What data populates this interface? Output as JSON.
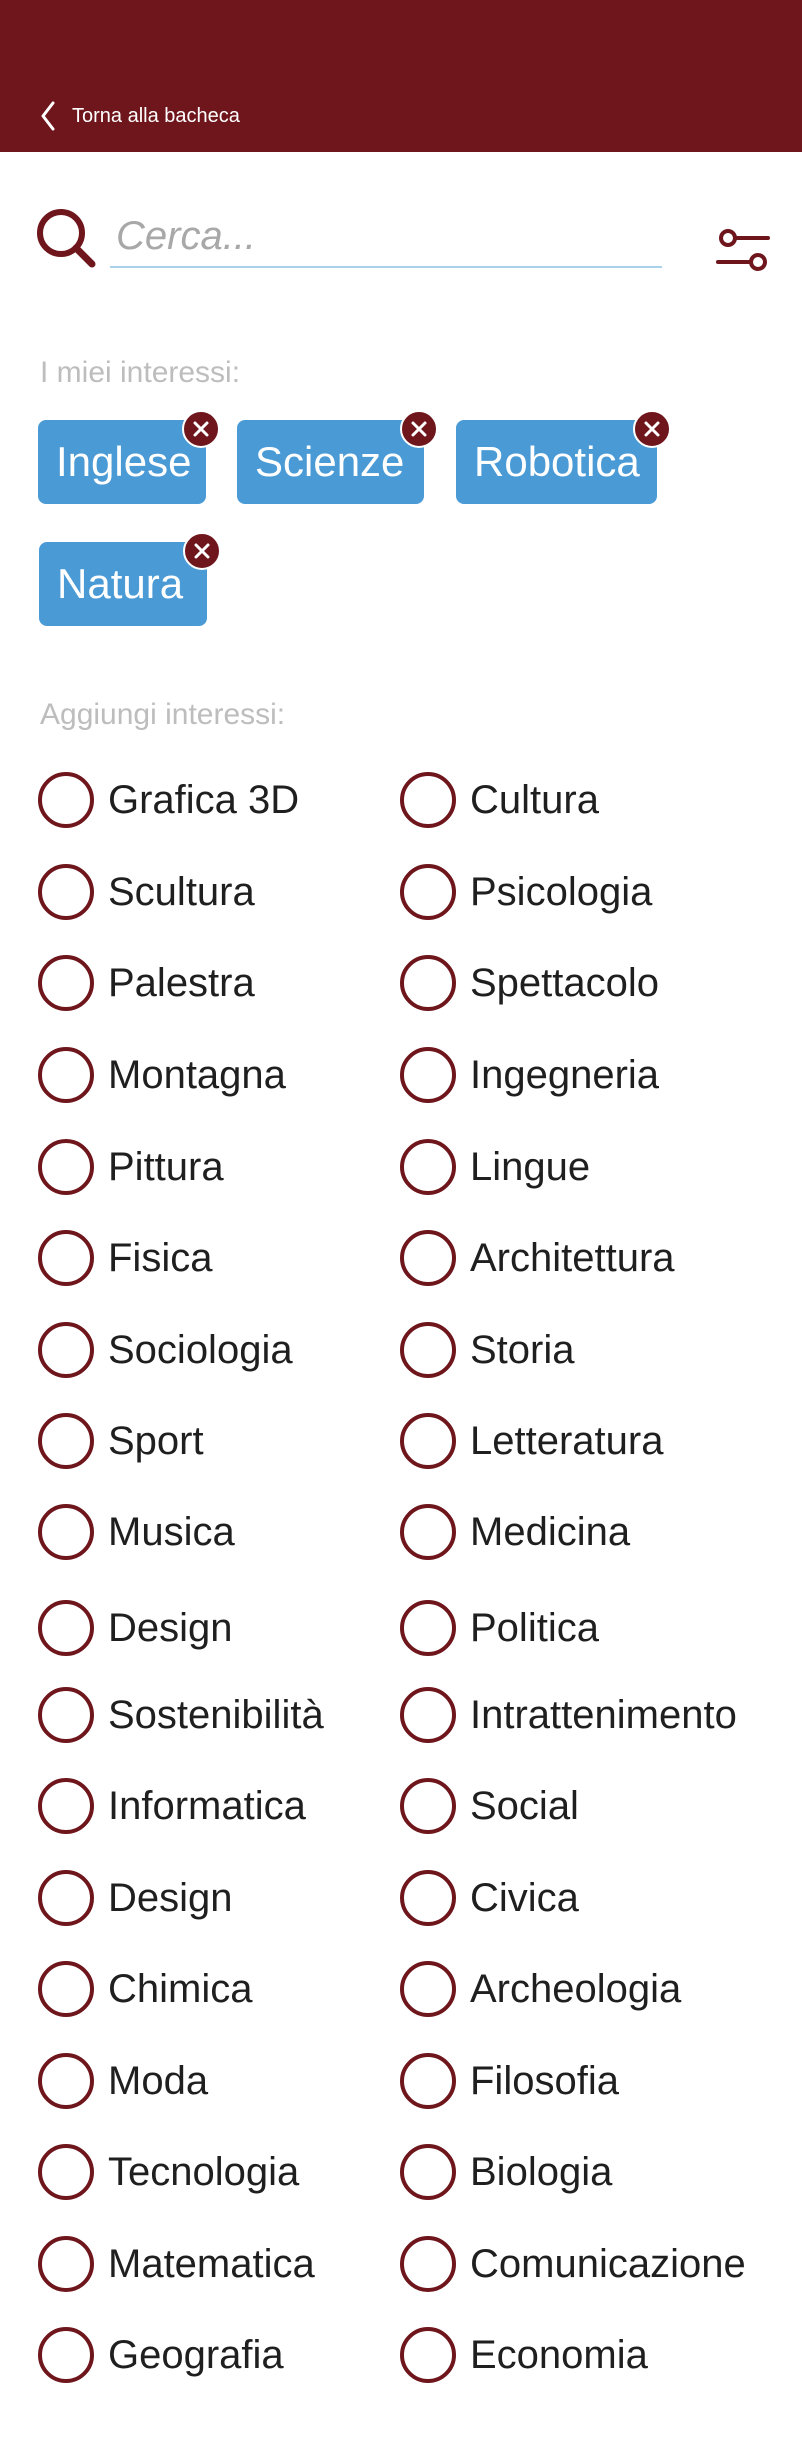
{
  "header": {
    "back_label": "Torna alla bacheca"
  },
  "search": {
    "placeholder": "Cerca..."
  },
  "my_interests": {
    "label": "I miei interessi:",
    "chips": [
      "Inglese",
      "Scienze",
      "Robotica",
      "Natura"
    ]
  },
  "add_interests": {
    "label": "Aggiungi interessi:",
    "rows": [
      [
        "Grafica 3D",
        "Cultura"
      ],
      [
        "Scultura",
        "Psicologia"
      ],
      [
        "Palestra",
        "Spettacolo"
      ],
      [
        "Montagna",
        "Ingegneria"
      ],
      [
        "Pittura",
        "Lingue"
      ],
      [
        "Fisica",
        "Architettura"
      ],
      [
        "Sociologia",
        "Storia"
      ],
      [
        "Sport",
        "Letteratura"
      ],
      [
        "Musica",
        "Medicina"
      ],
      [
        "Design",
        "Politica"
      ],
      [
        "Sostenibilità",
        "Intrattenimento"
      ],
      [
        "Informatica",
        "Social"
      ],
      [
        "Design",
        "Civica"
      ],
      [
        "Chimica",
        "Archeologia"
      ],
      [
        "Moda",
        "Filosofia"
      ],
      [
        "Tecnologia",
        "Biologia"
      ],
      [
        "Matematica",
        "Comunicazione"
      ],
      [
        "Geografia",
        "Economia"
      ]
    ]
  },
  "colors": {
    "brand": "#6e161c",
    "chip": "#4a9ad6",
    "label_gray": "#bdbdbd",
    "search_underline": "#a9d2ea"
  },
  "icons": {
    "back": "chevron-left-icon",
    "search": "search-icon",
    "filter": "filter-sliders-icon",
    "remove": "close-icon",
    "option": "radio-empty-icon"
  }
}
